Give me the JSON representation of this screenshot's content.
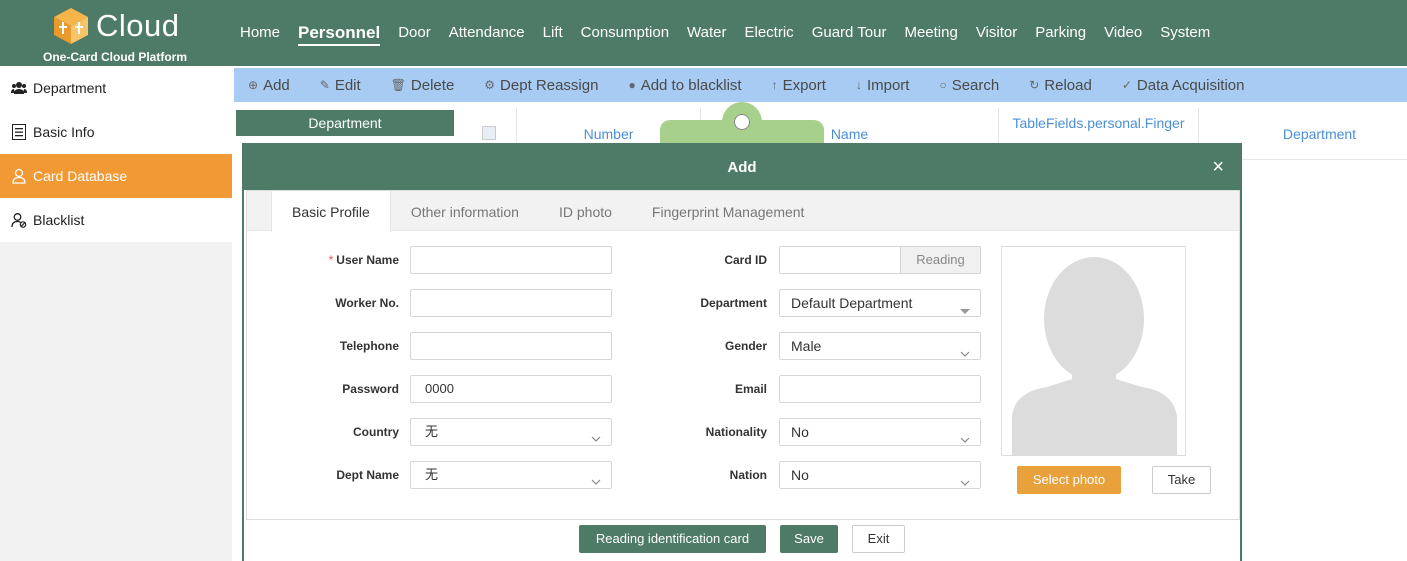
{
  "app": {
    "logo_text": "Cloud",
    "logo_subtitle": "One-Card Cloud Platform"
  },
  "nav": {
    "items": [
      "Home",
      "Personnel",
      "Door",
      "Attendance",
      "Lift",
      "Consumption",
      "Water",
      "Electric",
      "Guard Tour",
      "Meeting",
      "Visitor",
      "Parking",
      "Video",
      "System"
    ],
    "active": "Personnel"
  },
  "sidebar": {
    "items": [
      {
        "label": "Department",
        "icon": "group-icon"
      },
      {
        "label": "Basic Info",
        "icon": "list-icon"
      },
      {
        "label": "Card Database",
        "icon": "user-icon"
      },
      {
        "label": "Blacklist",
        "icon": "user-block-icon"
      }
    ],
    "active": "Card Database"
  },
  "toolbar": {
    "items": [
      {
        "label": "Add",
        "icon": "⊕"
      },
      {
        "label": "Edit",
        "icon": "✎"
      },
      {
        "label": "Delete",
        "icon": "🗑"
      },
      {
        "label": "Dept Reassign",
        "icon": "⚙"
      },
      {
        "label": "Add to blacklist",
        "icon": "●"
      },
      {
        "label": "Export",
        "icon": "↑"
      },
      {
        "label": "Import",
        "icon": "↓"
      },
      {
        "label": "Search",
        "icon": "○"
      },
      {
        "label": "Reload",
        "icon": "↻"
      },
      {
        "label": "Data Acquisition",
        "icon": "✓"
      }
    ]
  },
  "dept_panel": {
    "title": "Department"
  },
  "grid": {
    "columns": [
      "Number",
      "Name",
      "TableFields.personal.Finger",
      "Department"
    ]
  },
  "modal": {
    "title": "Add",
    "close": "×",
    "tabs": [
      "Basic Profile",
      "Other information",
      "ID photo",
      "Fingerprint Management"
    ],
    "active_tab": "Basic Profile",
    "left_fields": [
      {
        "label": "User Name",
        "required": true,
        "value": "",
        "type": "input"
      },
      {
        "label": "Worker No.",
        "required": false,
        "value": "",
        "type": "input"
      },
      {
        "label": "Telephone",
        "required": false,
        "value": "",
        "type": "input"
      },
      {
        "label": "Password",
        "required": false,
        "value": "0000",
        "type": "input"
      },
      {
        "label": "Country",
        "required": false,
        "value": "无",
        "type": "select"
      },
      {
        "label": "Dept Name",
        "required": false,
        "value": "无",
        "type": "select"
      }
    ],
    "right_fields": [
      {
        "label": "Card ID",
        "value": "",
        "type": "input-button",
        "button": "Reading"
      },
      {
        "label": "Department",
        "value": "Default Department",
        "type": "select-solid"
      },
      {
        "label": "Gender",
        "value": "Male",
        "type": "select"
      },
      {
        "label": "Email",
        "value": "",
        "type": "input"
      },
      {
        "label": "Nationality",
        "value": "No",
        "type": "select"
      },
      {
        "label": "Nation",
        "value": "No",
        "type": "select"
      }
    ],
    "photo_buttons": {
      "select": "Select photo",
      "take": "Take"
    },
    "footer": {
      "read_id": "Reading identification card",
      "save": "Save",
      "exit": "Exit"
    }
  },
  "colors": {
    "primary_green": "#4e7b67",
    "accent_orange": "#f19a35",
    "toolbar_blue": "#a7cbf2",
    "link_blue": "#4a8fd8"
  }
}
